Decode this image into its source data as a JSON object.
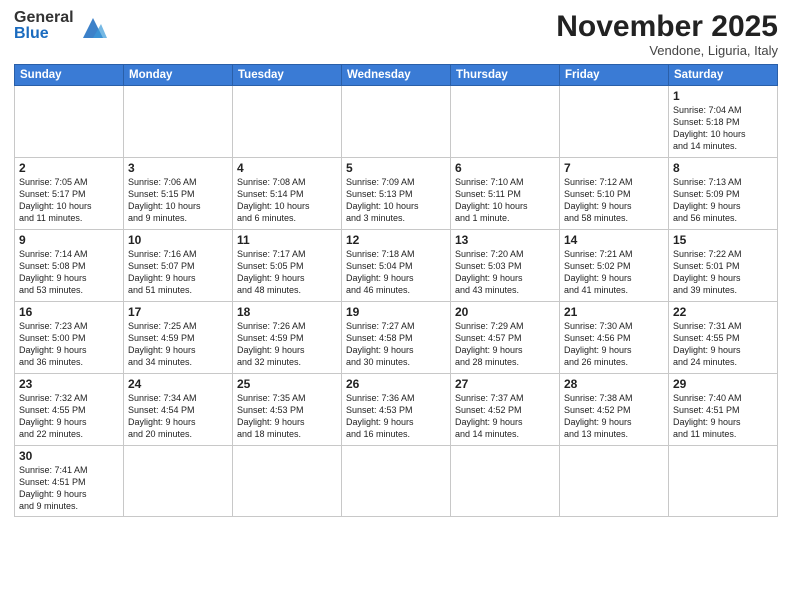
{
  "logo": {
    "general": "General",
    "blue": "Blue"
  },
  "header": {
    "month": "November 2025",
    "location": "Vendone, Liguria, Italy"
  },
  "weekdays": [
    "Sunday",
    "Monday",
    "Tuesday",
    "Wednesday",
    "Thursday",
    "Friday",
    "Saturday"
  ],
  "weeks": [
    [
      {
        "day": "",
        "info": ""
      },
      {
        "day": "",
        "info": ""
      },
      {
        "day": "",
        "info": ""
      },
      {
        "day": "",
        "info": ""
      },
      {
        "day": "",
        "info": ""
      },
      {
        "day": "",
        "info": ""
      },
      {
        "day": "1",
        "info": "Sunrise: 7:04 AM\nSunset: 5:18 PM\nDaylight: 10 hours\nand 14 minutes."
      }
    ],
    [
      {
        "day": "2",
        "info": "Sunrise: 7:05 AM\nSunset: 5:17 PM\nDaylight: 10 hours\nand 11 minutes."
      },
      {
        "day": "3",
        "info": "Sunrise: 7:06 AM\nSunset: 5:15 PM\nDaylight: 10 hours\nand 9 minutes."
      },
      {
        "day": "4",
        "info": "Sunrise: 7:08 AM\nSunset: 5:14 PM\nDaylight: 10 hours\nand 6 minutes."
      },
      {
        "day": "5",
        "info": "Sunrise: 7:09 AM\nSunset: 5:13 PM\nDaylight: 10 hours\nand 3 minutes."
      },
      {
        "day": "6",
        "info": "Sunrise: 7:10 AM\nSunset: 5:11 PM\nDaylight: 10 hours\nand 1 minute."
      },
      {
        "day": "7",
        "info": "Sunrise: 7:12 AM\nSunset: 5:10 PM\nDaylight: 9 hours\nand 58 minutes."
      },
      {
        "day": "8",
        "info": "Sunrise: 7:13 AM\nSunset: 5:09 PM\nDaylight: 9 hours\nand 56 minutes."
      }
    ],
    [
      {
        "day": "9",
        "info": "Sunrise: 7:14 AM\nSunset: 5:08 PM\nDaylight: 9 hours\nand 53 minutes."
      },
      {
        "day": "10",
        "info": "Sunrise: 7:16 AM\nSunset: 5:07 PM\nDaylight: 9 hours\nand 51 minutes."
      },
      {
        "day": "11",
        "info": "Sunrise: 7:17 AM\nSunset: 5:05 PM\nDaylight: 9 hours\nand 48 minutes."
      },
      {
        "day": "12",
        "info": "Sunrise: 7:18 AM\nSunset: 5:04 PM\nDaylight: 9 hours\nand 46 minutes."
      },
      {
        "day": "13",
        "info": "Sunrise: 7:20 AM\nSunset: 5:03 PM\nDaylight: 9 hours\nand 43 minutes."
      },
      {
        "day": "14",
        "info": "Sunrise: 7:21 AM\nSunset: 5:02 PM\nDaylight: 9 hours\nand 41 minutes."
      },
      {
        "day": "15",
        "info": "Sunrise: 7:22 AM\nSunset: 5:01 PM\nDaylight: 9 hours\nand 39 minutes."
      }
    ],
    [
      {
        "day": "16",
        "info": "Sunrise: 7:23 AM\nSunset: 5:00 PM\nDaylight: 9 hours\nand 36 minutes."
      },
      {
        "day": "17",
        "info": "Sunrise: 7:25 AM\nSunset: 4:59 PM\nDaylight: 9 hours\nand 34 minutes."
      },
      {
        "day": "18",
        "info": "Sunrise: 7:26 AM\nSunset: 4:59 PM\nDaylight: 9 hours\nand 32 minutes."
      },
      {
        "day": "19",
        "info": "Sunrise: 7:27 AM\nSunset: 4:58 PM\nDaylight: 9 hours\nand 30 minutes."
      },
      {
        "day": "20",
        "info": "Sunrise: 7:29 AM\nSunset: 4:57 PM\nDaylight: 9 hours\nand 28 minutes."
      },
      {
        "day": "21",
        "info": "Sunrise: 7:30 AM\nSunset: 4:56 PM\nDaylight: 9 hours\nand 26 minutes."
      },
      {
        "day": "22",
        "info": "Sunrise: 7:31 AM\nSunset: 4:55 PM\nDaylight: 9 hours\nand 24 minutes."
      }
    ],
    [
      {
        "day": "23",
        "info": "Sunrise: 7:32 AM\nSunset: 4:55 PM\nDaylight: 9 hours\nand 22 minutes."
      },
      {
        "day": "24",
        "info": "Sunrise: 7:34 AM\nSunset: 4:54 PM\nDaylight: 9 hours\nand 20 minutes."
      },
      {
        "day": "25",
        "info": "Sunrise: 7:35 AM\nSunset: 4:53 PM\nDaylight: 9 hours\nand 18 minutes."
      },
      {
        "day": "26",
        "info": "Sunrise: 7:36 AM\nSunset: 4:53 PM\nDaylight: 9 hours\nand 16 minutes."
      },
      {
        "day": "27",
        "info": "Sunrise: 7:37 AM\nSunset: 4:52 PM\nDaylight: 9 hours\nand 14 minutes."
      },
      {
        "day": "28",
        "info": "Sunrise: 7:38 AM\nSunset: 4:52 PM\nDaylight: 9 hours\nand 13 minutes."
      },
      {
        "day": "29",
        "info": "Sunrise: 7:40 AM\nSunset: 4:51 PM\nDaylight: 9 hours\nand 11 minutes."
      }
    ],
    [
      {
        "day": "30",
        "info": "Sunrise: 7:41 AM\nSunset: 4:51 PM\nDaylight: 9 hours\nand 9 minutes."
      },
      {
        "day": "",
        "info": ""
      },
      {
        "day": "",
        "info": ""
      },
      {
        "day": "",
        "info": ""
      },
      {
        "day": "",
        "info": ""
      },
      {
        "day": "",
        "info": ""
      },
      {
        "day": "",
        "info": ""
      }
    ]
  ]
}
